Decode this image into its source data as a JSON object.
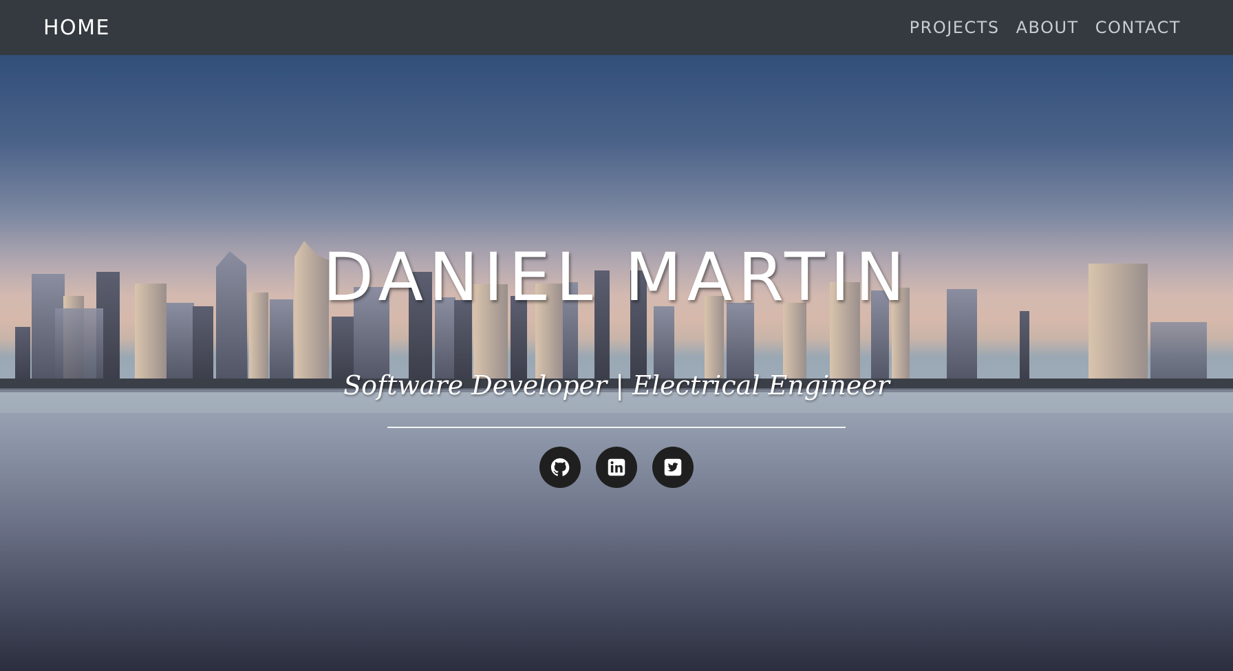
{
  "navbar": {
    "brand": "HOME",
    "links": [
      {
        "label": "PROJECTS"
      },
      {
        "label": "ABOUT"
      },
      {
        "label": "CONTACT"
      }
    ]
  },
  "hero": {
    "title": "DANIEL MARTIN",
    "subtitle": "Software Developer | Electrical Engineer",
    "socials": [
      {
        "icon": "github-icon"
      },
      {
        "icon": "linkedin-icon"
      },
      {
        "icon": "twitter-icon"
      }
    ]
  },
  "colors": {
    "navbar_bg": "#343a40",
    "nav_link": "#c9ccd0",
    "social_bg": "#1f1f1f"
  }
}
